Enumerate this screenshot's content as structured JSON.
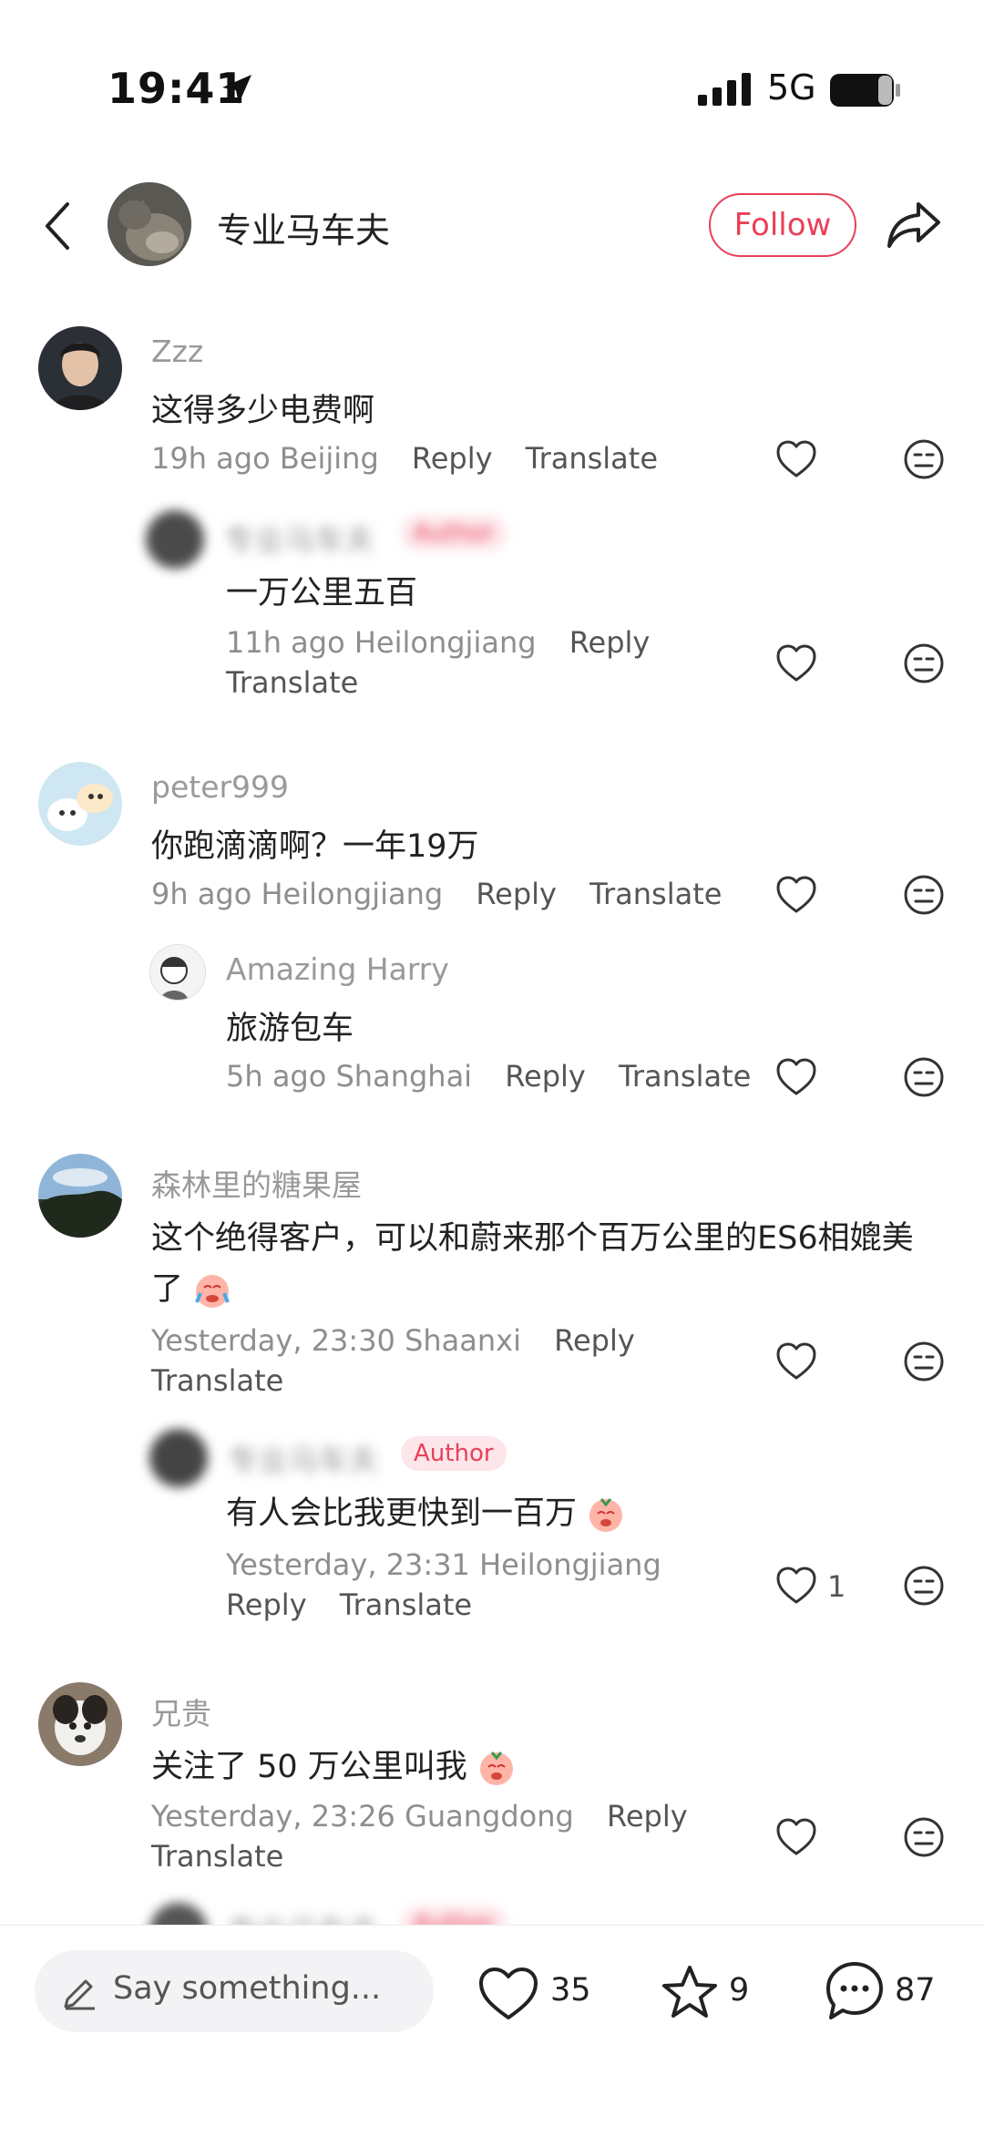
{
  "status_bar": {
    "time": "19:41",
    "network": "5G"
  },
  "header": {
    "username": "专业马车夫",
    "follow_label": "Follow"
  },
  "comments": [
    {
      "user": "Zzz",
      "text": "这得多少电费啊",
      "time": "19h ago",
      "location": "Beijing",
      "reply": "Reply",
      "translate": "Translate"
    },
    {
      "user": "专业马车夫",
      "badge": "Author",
      "text": "一万公里五百",
      "time": "11h ago",
      "location": "Heilongjiang",
      "reply": "Reply",
      "translate": "Translate"
    },
    {
      "user": "peter999",
      "text": "你跑滴滴啊？一年19万",
      "time": "9h ago",
      "location": "Heilongjiang",
      "reply": "Reply",
      "translate": "Translate"
    },
    {
      "user": "Amazing Harry",
      "text": "旅游包车",
      "time": "5h ago",
      "location": "Shanghai",
      "reply": "Reply",
      "translate": "Translate"
    },
    {
      "user": "森林里的糖果屋",
      "text_line1": "这个绝得客户，可以和蔚来那个百万公里的ES6相媲美",
      "text_line2": "了",
      "time": "Yesterday, 23:30",
      "location": "Shaanxi",
      "reply": "Reply",
      "translate": "Translate"
    },
    {
      "user": "专业马车夫",
      "badge": "Author",
      "text": "有人会比我更快到一百万",
      "time": "Yesterday, 23:31",
      "location": "Heilongjiang",
      "reply": "Reply",
      "translate": "Translate",
      "likes": "1"
    },
    {
      "user": "兄贵",
      "text": "关注了 50 万公里叫我",
      "time": "Yesterday, 23:26",
      "location": "Guangdong",
      "reply": "Reply",
      "translate": "Translate"
    },
    {
      "user": "专业马车夫",
      "badge": "Author"
    }
  ],
  "bottom_bar": {
    "placeholder": "Say something...",
    "likes": "35",
    "favorites": "9",
    "comments": "87"
  },
  "colors": {
    "accent": "#e8405a",
    "muted": "#8e8e8e"
  }
}
